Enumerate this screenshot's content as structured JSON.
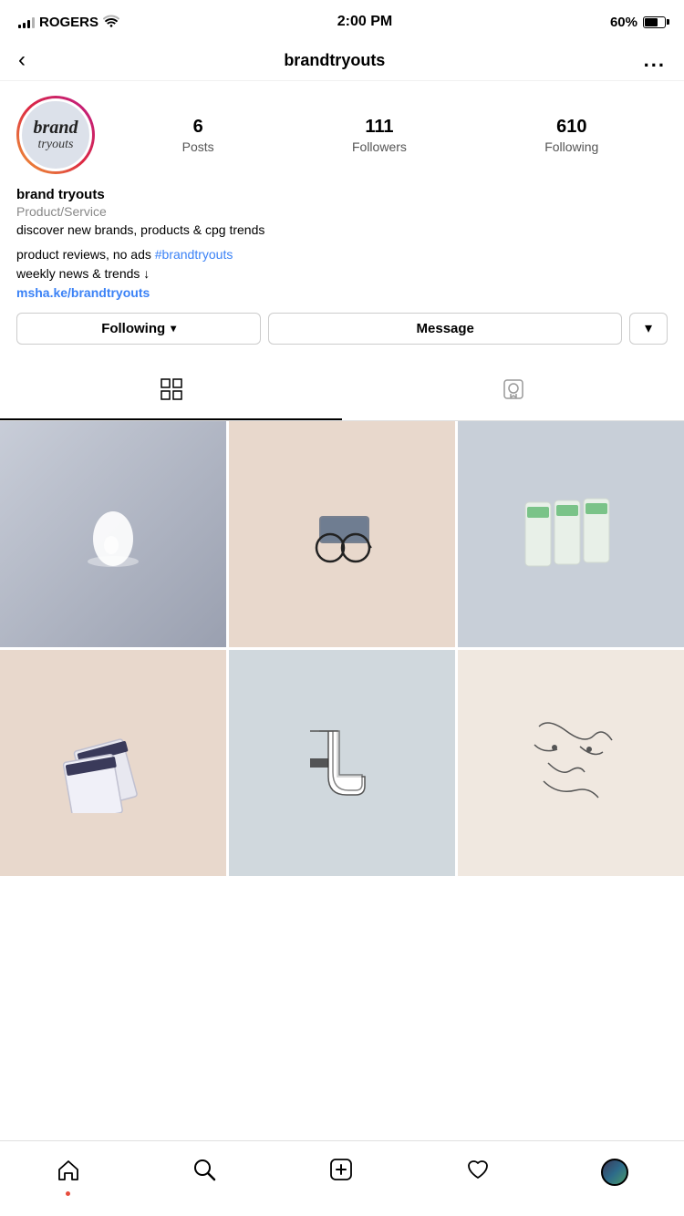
{
  "statusBar": {
    "carrier": "ROGERS",
    "time": "2:00 PM",
    "battery": "60%"
  },
  "header": {
    "back_label": "<",
    "title": "brandtryouts",
    "more_label": "..."
  },
  "profile": {
    "avatar_brand": "brand",
    "avatar_tryouts": "tryouts",
    "stats": [
      {
        "number": "6",
        "label": "Posts"
      },
      {
        "number": "111",
        "label": "Followers"
      },
      {
        "number": "610",
        "label": "Following"
      }
    ],
    "name": "brand tryouts",
    "category": "Product/Service",
    "desc": "discover new brands, products & cpg trends",
    "bio_line1": "product reviews, no ads ",
    "hashtag": "#brandtryouts",
    "bio_line2": "weekly news & trends ↓",
    "link": "msha.ke/brandtryouts"
  },
  "actions": {
    "following_label": "Following",
    "message_label": "Message",
    "dropdown_label": "▾"
  },
  "tabs": {
    "grid_label": "Grid",
    "tagged_label": "Tagged"
  },
  "bottomNav": {
    "home": "Home",
    "search": "Search",
    "add": "Add",
    "heart": "Activity",
    "profile": "Profile"
  }
}
